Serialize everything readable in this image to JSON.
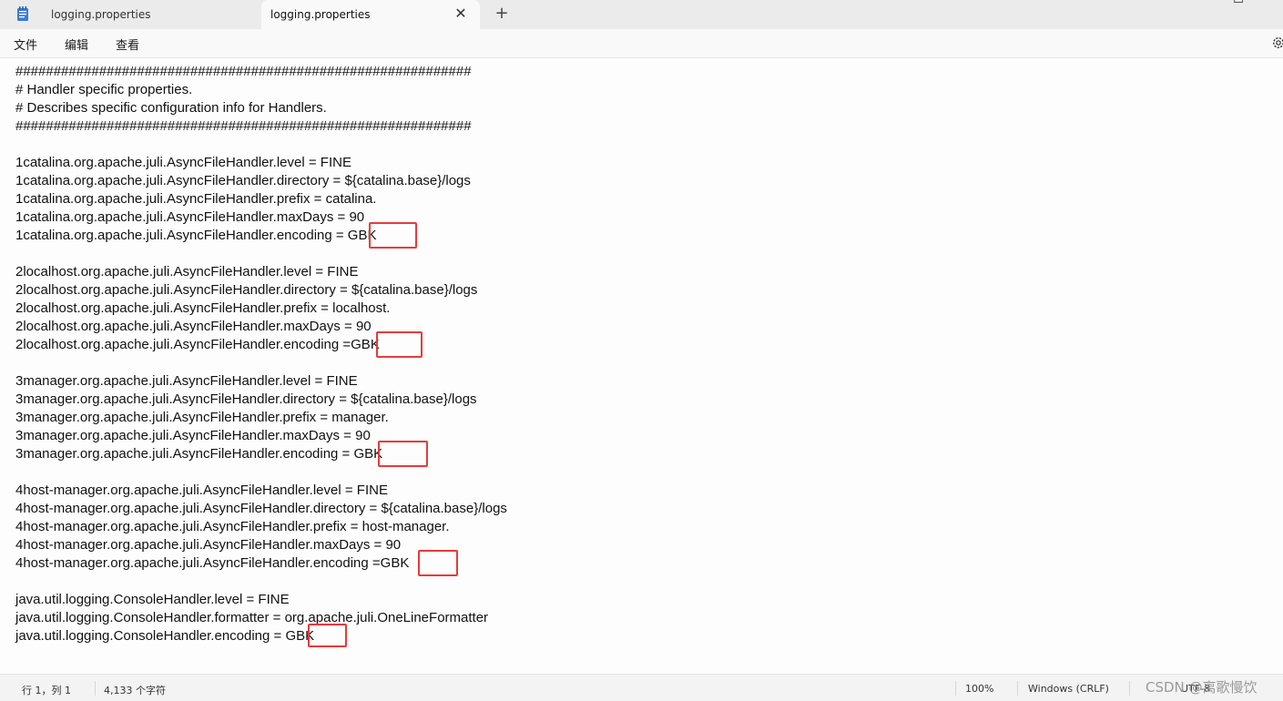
{
  "tabs": [
    {
      "label": "logging.properties",
      "active": false
    },
    {
      "label": "logging.properties",
      "active": true
    }
  ],
  "tab_close": "✕",
  "new_tab": "+",
  "window_controls": {
    "minimize": "—",
    "maximize": "☐"
  },
  "menu": [
    "文件",
    "编辑",
    "查看"
  ],
  "editor_lines": [
    "############################################################",
    "# Handler specific properties.",
    "# Describes specific configuration info for Handlers.",
    "############################################################",
    "",
    "1catalina.org.apache.juli.AsyncFileHandler.level = FINE",
    "1catalina.org.apache.juli.AsyncFileHandler.directory = ${catalina.base}/logs",
    "1catalina.org.apache.juli.AsyncFileHandler.prefix = catalina.",
    "1catalina.org.apache.juli.AsyncFileHandler.maxDays = 90",
    "1catalina.org.apache.juli.AsyncFileHandler.encoding = GBK",
    "",
    "2localhost.org.apache.juli.AsyncFileHandler.level = FINE",
    "2localhost.org.apache.juli.AsyncFileHandler.directory = ${catalina.base}/logs",
    "2localhost.org.apache.juli.AsyncFileHandler.prefix = localhost.",
    "2localhost.org.apache.juli.AsyncFileHandler.maxDays = 90",
    "2localhost.org.apache.juli.AsyncFileHandler.encoding =GBK",
    "",
    "3manager.org.apache.juli.AsyncFileHandler.level = FINE",
    "3manager.org.apache.juli.AsyncFileHandler.directory = ${catalina.base}/logs",
    "3manager.org.apache.juli.AsyncFileHandler.prefix = manager.",
    "3manager.org.apache.juli.AsyncFileHandler.maxDays = 90",
    "3manager.org.apache.juli.AsyncFileHandler.encoding = GBK",
    "",
    "4host-manager.org.apache.juli.AsyncFileHandler.level = FINE",
    "4host-manager.org.apache.juli.AsyncFileHandler.directory = ${catalina.base}/logs",
    "4host-manager.org.apache.juli.AsyncFileHandler.prefix = host-manager.",
    "4host-manager.org.apache.juli.AsyncFileHandler.maxDays = 90",
    "4host-manager.org.apache.juli.AsyncFileHandler.encoding =GBK",
    "",
    "java.util.logging.ConsoleHandler.level = FINE",
    "java.util.logging.ConsoleHandler.formatter = org.apache.juli.OneLineFormatter",
    "java.util.logging.ConsoleHandler.encoding = GBK"
  ],
  "highlight_color": "#e53b3b",
  "status": {
    "position": "行 1，列 1",
    "char_count": "4,133 个字符",
    "zoom": "100%",
    "line_ending": "Windows (CRLF)",
    "encoding": "UTF-8"
  },
  "watermark": "CSDN @离歌慢饮"
}
